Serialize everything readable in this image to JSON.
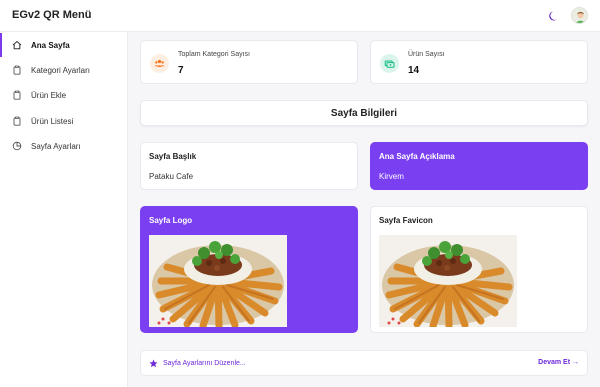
{
  "header": {
    "title": "EGv2 QR Menü",
    "theme_icon": "moon-icon",
    "avatar_icon": "user-avatar-icon"
  },
  "sidebar": {
    "items": [
      {
        "label": "Ana Sayfa",
        "icon": "home-icon",
        "active": true
      },
      {
        "label": "Kategori Ayarları",
        "icon": "clipboard-icon",
        "active": false
      },
      {
        "label": "Ürün Ekle",
        "icon": "clipboard-icon",
        "active": false
      },
      {
        "label": "Ürün Listesi",
        "icon": "clipboard-icon",
        "active": false
      },
      {
        "label": "Sayfa Ayarları",
        "icon": "pie-chart-icon",
        "active": false
      }
    ]
  },
  "stats": [
    {
      "label": "Toplam Kategori Sayısı",
      "value": "7",
      "icon": "users-group-icon",
      "color": "#f97316",
      "bg": "#fdeee3"
    },
    {
      "label": "Ürün Sayısı",
      "value": "14",
      "icon": "money-icon",
      "color": "#10b981",
      "bg": "#dcf5ec"
    }
  ],
  "section": {
    "title": "Sayfa Bilgileri"
  },
  "info": {
    "page_title_label": "Sayfa Başlık",
    "page_title_value": "Pataku Cafe",
    "description_label": "Ana Sayfa Açıklama",
    "description_value": "Kirvem",
    "logo_label": "Sayfa Logo",
    "favicon_label": "Sayfa Favicon"
  },
  "footer": {
    "edit_label": "Sayfa Ayarlarını Düzenle...",
    "continue_label": "Devam Et →",
    "star_icon": "star-icon"
  },
  "colors": {
    "accent": "#7b3ff2",
    "link": "#6d28d9"
  }
}
